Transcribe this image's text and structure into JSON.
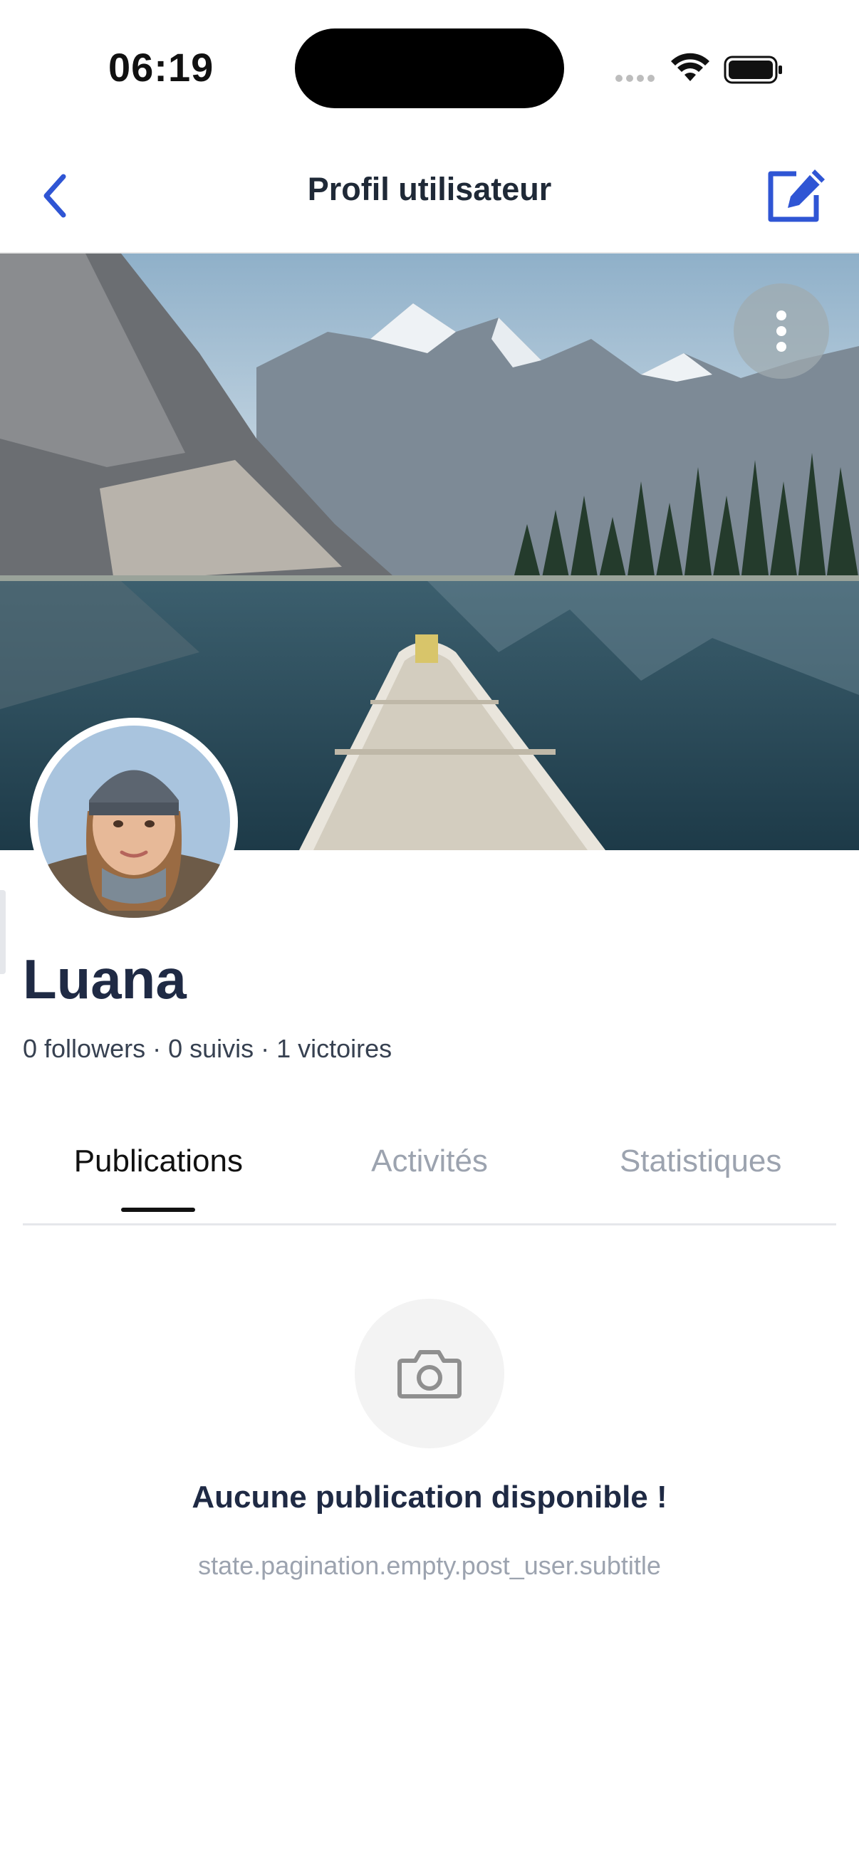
{
  "status_bar": {
    "time": "06:19"
  },
  "header": {
    "title": "Profil utilisateur"
  },
  "profile": {
    "name": "Luana",
    "stats": "0 followers · 0 suivis · 1 victoires"
  },
  "tabs": [
    {
      "label": "Publications",
      "active": true
    },
    {
      "label": "Activités",
      "active": false
    },
    {
      "label": "Statistiques",
      "active": false
    }
  ],
  "empty_state": {
    "icon": "camera-icon",
    "title": "Aucune publication disponible !",
    "subtitle": "state.pagination.empty.post_user.subtitle"
  },
  "colors": {
    "accent": "#2f55d4",
    "title": "#1f2a44",
    "muted": "#9ca3af"
  }
}
